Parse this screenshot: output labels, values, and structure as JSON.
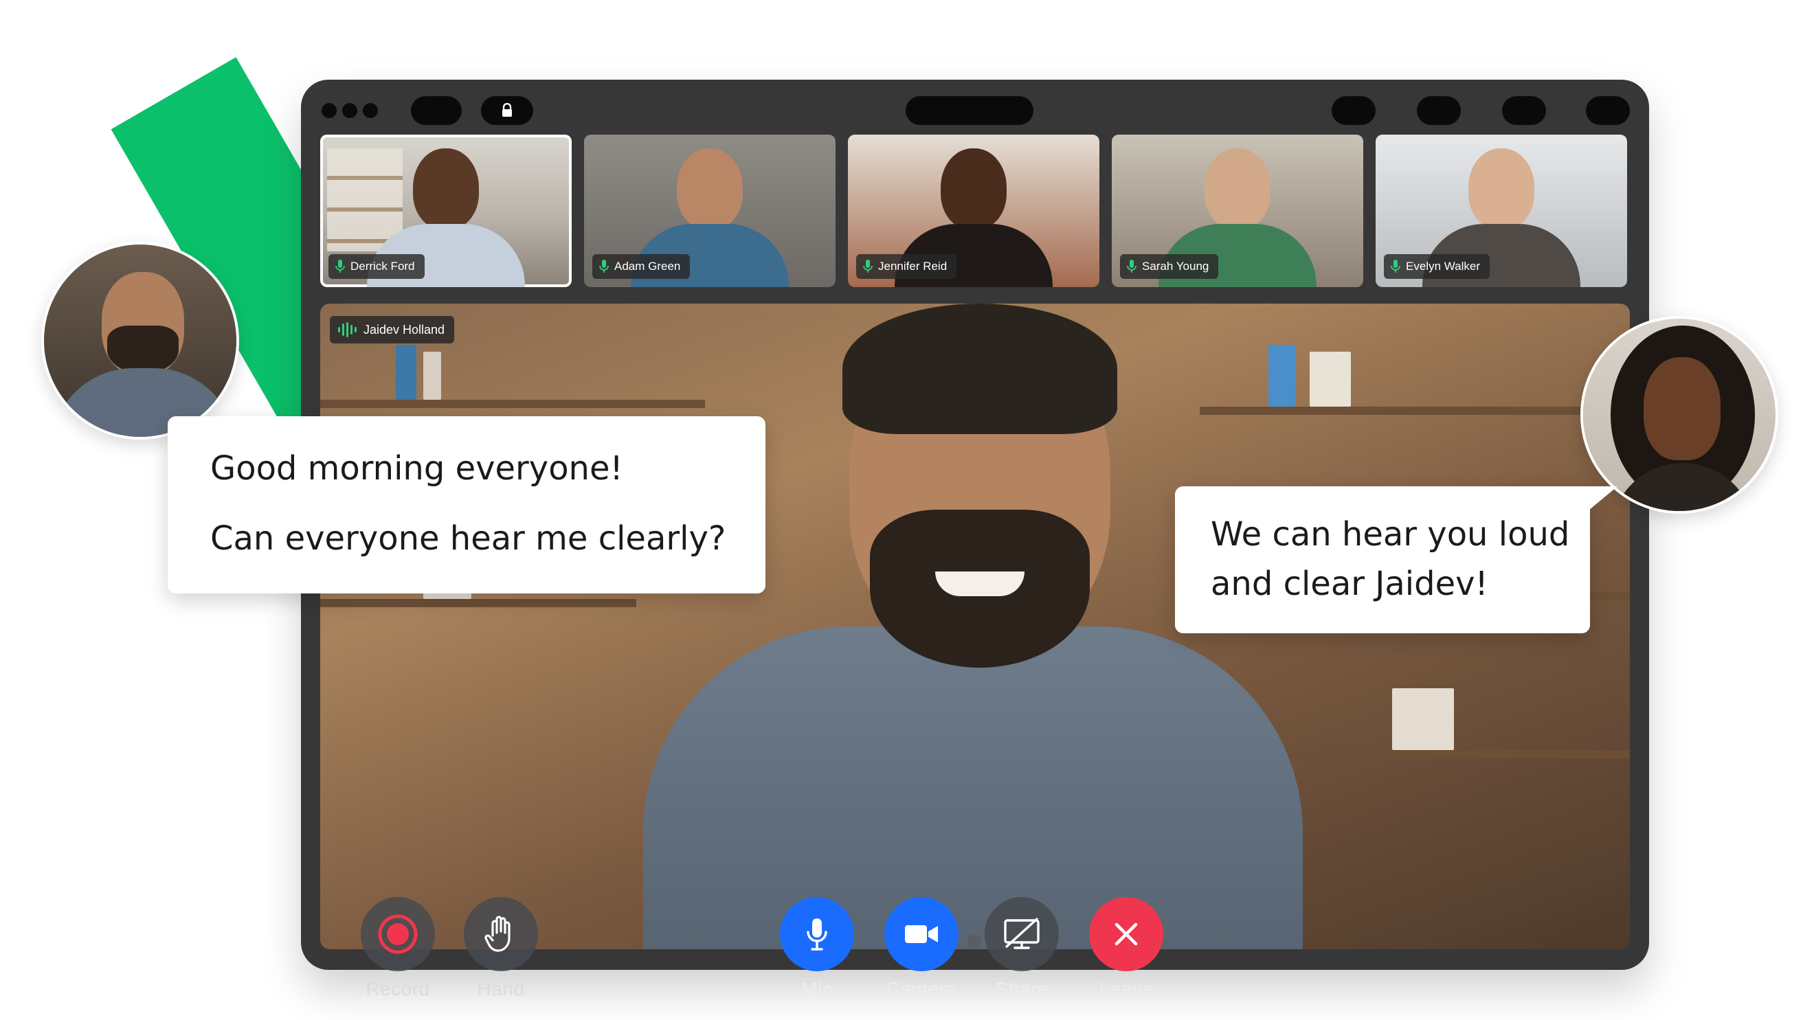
{
  "participants": [
    {
      "name": "Derrick Ford"
    },
    {
      "name": "Adam Green"
    },
    {
      "name": "Jennifer Reid"
    },
    {
      "name": "Sarah Young"
    },
    {
      "name": "Evelyn Walker"
    }
  ],
  "speaker": {
    "name": "Jaidev Holland"
  },
  "chat": {
    "left_line1": "Good morning everyone!",
    "left_line2": "Can everyone hear me clearly?",
    "right_line1": "We can hear you loud",
    "right_line2": "and clear Jaidev!"
  },
  "controls": {
    "record": "Record",
    "hand": "Hand",
    "mic": "Mic",
    "camera": "Camera",
    "share": "Share",
    "leave": "Leave"
  },
  "icons": [
    "lock-icon",
    "mic-icon",
    "audio-wave-icon",
    "record-icon",
    "hand-icon",
    "camera-icon",
    "share-screen-off-icon",
    "close-icon"
  ],
  "colors": {
    "accent_green": "#0bc06a",
    "frame": "#373737",
    "mic_blue": "#1a6cff",
    "leave_red": "#f0364e",
    "control_gray": "#4a4f55"
  }
}
